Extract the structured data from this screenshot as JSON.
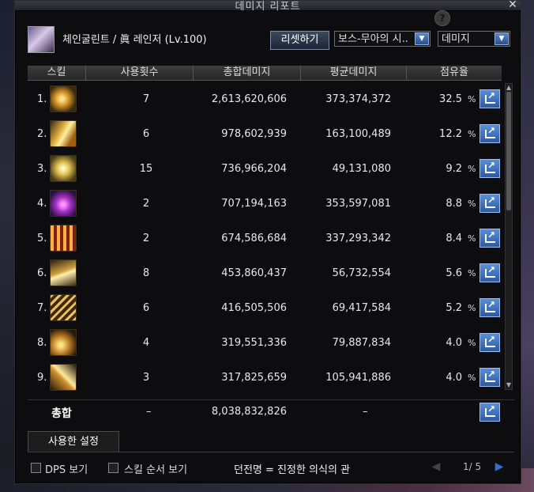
{
  "window": {
    "title": "데미지 리포트",
    "close_label": "✕",
    "help_label": "?"
  },
  "header": {
    "character_name": "체인굴린트 / 眞 레인저 (Lv.100)",
    "reset_button": "리셋하기",
    "boss_select": "보스-무아의 시..",
    "type_select": "데미지"
  },
  "table": {
    "columns": [
      "스킬",
      "사용횟수",
      "총합데미지",
      "평균데미지",
      "점유율"
    ],
    "percent_sign": "%",
    "rows": [
      {
        "rank": "1.",
        "icon": "skill-icon-1",
        "uses": "7",
        "total": "2,613,620,606",
        "avg": "373,374,372",
        "share": "32.5"
      },
      {
        "rank": "2.",
        "icon": "skill-icon-2",
        "uses": "6",
        "total": "978,602,939",
        "avg": "163,100,489",
        "share": "12.2"
      },
      {
        "rank": "3.",
        "icon": "skill-icon-3",
        "uses": "15",
        "total": "736,966,204",
        "avg": "49,131,080",
        "share": "9.2"
      },
      {
        "rank": "4.",
        "icon": "skill-icon-4",
        "uses": "2",
        "total": "707,194,163",
        "avg": "353,597,081",
        "share": "8.8"
      },
      {
        "rank": "5.",
        "icon": "skill-icon-5",
        "uses": "2",
        "total": "674,586,684",
        "avg": "337,293,342",
        "share": "8.4"
      },
      {
        "rank": "6.",
        "icon": "skill-icon-6",
        "uses": "8",
        "total": "453,860,437",
        "avg": "56,732,554",
        "share": "5.6"
      },
      {
        "rank": "7.",
        "icon": "skill-icon-7",
        "uses": "6",
        "total": "416,505,506",
        "avg": "69,417,584",
        "share": "5.2"
      },
      {
        "rank": "8.",
        "icon": "skill-icon-8",
        "uses": "4",
        "total": "319,551,336",
        "avg": "79,887,834",
        "share": "4.0"
      },
      {
        "rank": "9.",
        "icon": "skill-icon-9",
        "uses": "3",
        "total": "317,825,659",
        "avg": "105,941,886",
        "share": "4.0"
      }
    ],
    "total": {
      "label": "총합",
      "uses": "–",
      "total": "8,038,832,826",
      "avg": "–"
    }
  },
  "tabs": {
    "settings": "사용한 설정"
  },
  "footer": {
    "dps_label": "DPS 보기",
    "order_label": "스킬 순서 보기",
    "title_info": "던전명 = 진정한 의식의 관",
    "page": "1/ 5"
  },
  "colors": {
    "accent_blue": "#2b5aa6",
    "share_button": "#5b8ed6",
    "background": "#0d0d10"
  }
}
